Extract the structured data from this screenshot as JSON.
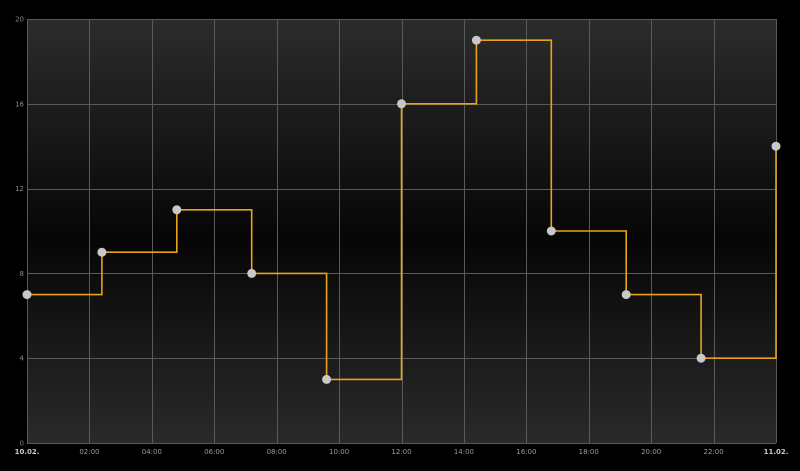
{
  "chart_data": {
    "type": "line",
    "step": "after",
    "title": "",
    "xlabel": "",
    "ylabel": "",
    "ylim": [
      0,
      20
    ],
    "yticks": [
      0,
      4,
      8,
      12,
      16,
      20
    ],
    "x_range": [
      "10.02. 00:00",
      "11.02. 00:00"
    ],
    "x_ticks": [
      {
        "value": "10.02. 00:00",
        "label": "10.02.",
        "bold": true
      },
      {
        "value": "10.02. 02:00",
        "label": "02:00",
        "bold": false
      },
      {
        "value": "10.02. 04:00",
        "label": "04:00",
        "bold": false
      },
      {
        "value": "10.02. 06:00",
        "label": "06:00",
        "bold": false
      },
      {
        "value": "10.02. 08:00",
        "label": "08:00",
        "bold": false
      },
      {
        "value": "10.02. 10:00",
        "label": "10:00",
        "bold": false
      },
      {
        "value": "10.02. 12:00",
        "label": "12:00",
        "bold": false
      },
      {
        "value": "10.02. 14:00",
        "label": "14:00",
        "bold": false
      },
      {
        "value": "10.02. 16:00",
        "label": "16:00",
        "bold": false
      },
      {
        "value": "10.02. 18:00",
        "label": "18:00",
        "bold": false
      },
      {
        "value": "10.02. 20:00",
        "label": "20:00",
        "bold": false
      },
      {
        "value": "10.02. 22:00",
        "label": "22:00",
        "bold": false
      },
      {
        "value": "11.02. 00:00",
        "label": "11.02.",
        "bold": true
      }
    ],
    "grid": true,
    "series": [
      {
        "color": "#e8a317",
        "marker_color": "#c8c8c8",
        "points": [
          {
            "x": "10.02. 00:00",
            "y": 7
          },
          {
            "x": "10.02. 02:24",
            "y": 9
          },
          {
            "x": "10.02. 04:48",
            "y": 11
          },
          {
            "x": "10.02. 07:12",
            "y": 8
          },
          {
            "x": "10.02. 09:36",
            "y": 3
          },
          {
            "x": "10.02. 12:00",
            "y": 16
          },
          {
            "x": "10.02. 14:24",
            "y": 19
          },
          {
            "x": "10.02. 16:48",
            "y": 10
          },
          {
            "x": "10.02. 19:12",
            "y": 7
          },
          {
            "x": "10.02. 21:36",
            "y": 4
          },
          {
            "x": "11.02. 00:00",
            "y": 14
          }
        ]
      }
    ]
  }
}
